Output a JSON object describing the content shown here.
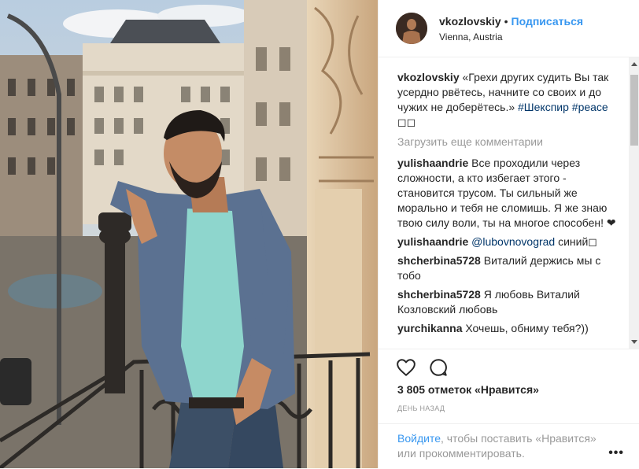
{
  "post": {
    "username": "vkozlovskiy",
    "dot": "•",
    "follow_label": "Подписаться",
    "location": "Vienna, Austria"
  },
  "caption": {
    "username": "vkozlovskiy",
    "text": "«Грехи других судить Вы так усердно рвётесь, начните со своих и до чужих не доберётесь.»",
    "tag1": "#Шекспир",
    "tag2": "#peace",
    "emoji": "◻◻"
  },
  "load_more": "Загрузить еще комментарии",
  "comments": [
    {
      "user": "yulishaandrie",
      "text": "Все проходили через сложности, а кто избегает этого - становится трусом. Ты сильный же морально и тебя не сломишь. Я же знаю твою силу воли, ты на многое способен! ❤"
    },
    {
      "user": "yulishaandrie",
      "mention": "@lubovnovograd",
      "text": "синий◻"
    },
    {
      "user": "shcherbina5728",
      "text": "Виталий держись мы с тобо"
    },
    {
      "user": "shcherbina5728",
      "text": "Я любовь Виталий Козловский любовь"
    },
    {
      "user": "yurchikanna",
      "text": "Хочешь, обниму тебя?))"
    }
  ],
  "likes": "3 805 отметок «Нравится»",
  "date": "ДЕНЬ НАЗАД",
  "footer": {
    "login": "Войдите",
    "rest": ", чтобы поставить «Нравится» или прокомментировать."
  },
  "icons": {
    "like": "heart-icon",
    "comment": "comment-icon",
    "more": "more-options-icon"
  },
  "colors": {
    "link": "#3897f0",
    "text": "#262626",
    "muted": "#999999"
  }
}
